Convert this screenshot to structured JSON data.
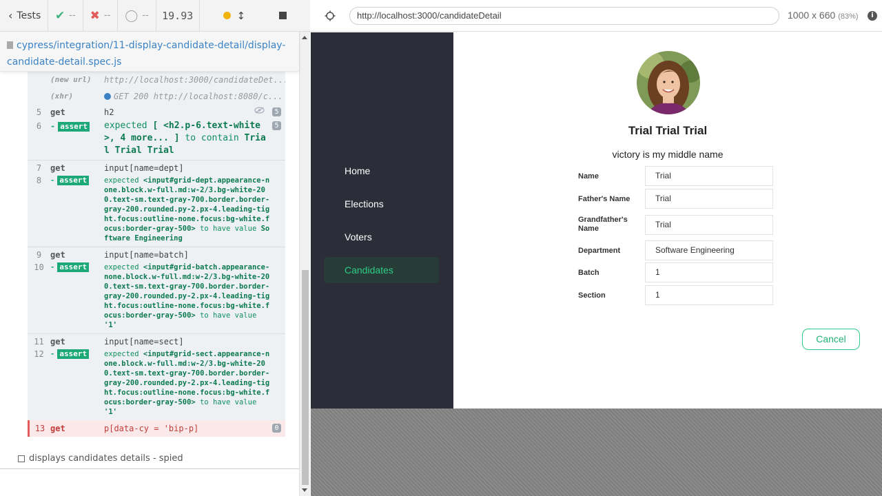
{
  "reporter": {
    "tests_label": "Tests",
    "passed": "--",
    "failed": "--",
    "pending": "--",
    "duration": "19.93",
    "spec_path": "cypress/integration/11-display-candidate-detail/display-candidate-detail.spec.js",
    "commands": {
      "new_url_label": "(new url)",
      "new_url_value": "http://localhost:3000/candidateDet...",
      "xhr_label": "(xhr)",
      "xhr_value": "GET 200 http://localhost:8080/c...",
      "r5": {
        "num": "5",
        "method": "get",
        "msg": "h2",
        "count": "5"
      },
      "r6": {
        "num": "6",
        "method": "assert",
        "msg_a": "expected",
        "msg_b": "[ <h2.p-6.text-white>, 4 more... ]",
        "msg_c": "to contain",
        "msg_d": "Trial Trial Trial",
        "count": "5"
      },
      "r7": {
        "num": "7",
        "method": "get",
        "msg": "input[name=dept]"
      },
      "r8": {
        "num": "8",
        "method": "assert",
        "msg_a": "expected",
        "msg_b": "<input#grid-dept.appearance-none.block.w-full.md:w-2/3.bg-white-200.text-sm.text-gray-700.border.border-gray-200.rounded.py-2.px-4.leading-tight.focus:outline-none.focus:bg-white.focus:border-gray-500>",
        "msg_c": "to have value",
        "msg_d": "Software Engineering"
      },
      "r9": {
        "num": "9",
        "method": "get",
        "msg": "input[name=batch]"
      },
      "r10": {
        "num": "10",
        "method": "assert",
        "msg_a": "expected",
        "msg_b": "<input#grid-batch.appearance-none.block.w-full.md:w-2/3.bg-white-200.text-sm.text-gray-700.border.border-gray-200.rounded.py-2.px-4.leading-tight.focus:outline-none.focus:bg-white.focus:border-gray-500>",
        "msg_c": "to have value",
        "msg_d": "'1'"
      },
      "r11": {
        "num": "11",
        "method": "get",
        "msg": "input[name=sect]"
      },
      "r12": {
        "num": "12",
        "method": "assert",
        "msg_a": "expected",
        "msg_b": "<input#grid-sect.appearance-none.block.w-full.md:w-2/3.bg-white-200.text-sm.text-gray-700.border.border-gray-200.rounded.py-2.px-4.leading-tight.focus:outline-none.focus:bg-white.focus:border-gray-500>",
        "msg_c": "to have value",
        "msg_d": "'1'"
      },
      "r13": {
        "num": "13",
        "method": "get",
        "msg": "p[data-cy = 'bip-p]",
        "count": "0"
      }
    },
    "next_test": "displays candidates details - spied",
    "colors": {
      "pass": "#3fb27f",
      "fail": "#e35a5a",
      "assert": "#1ca877",
      "running": "#f2b30e"
    }
  },
  "aut": {
    "url": "http://localhost:3000/candidateDetail",
    "viewport": "1000 x 660",
    "scale": "(83%)",
    "nav": [
      "Home",
      "Elections",
      "Voters",
      "Candidates"
    ],
    "active_nav": "Candidates",
    "candidate": {
      "name": "Trial Trial Trial",
      "bio": "victory is my middle name",
      "fields": [
        {
          "label": "Name",
          "value": "Trial"
        },
        {
          "label": "Father's Name",
          "value": "Trial"
        },
        {
          "label": "Grandfather's Name",
          "value": "Trial"
        },
        {
          "label": "Department",
          "value": "Software Engineering"
        },
        {
          "label": "Batch",
          "value": "1"
        },
        {
          "label": "Section",
          "value": "1"
        }
      ]
    },
    "cancel_label": "Cancel",
    "colors": {
      "sidebar": "#2b2e38",
      "accent": "#2ecc8a"
    }
  }
}
